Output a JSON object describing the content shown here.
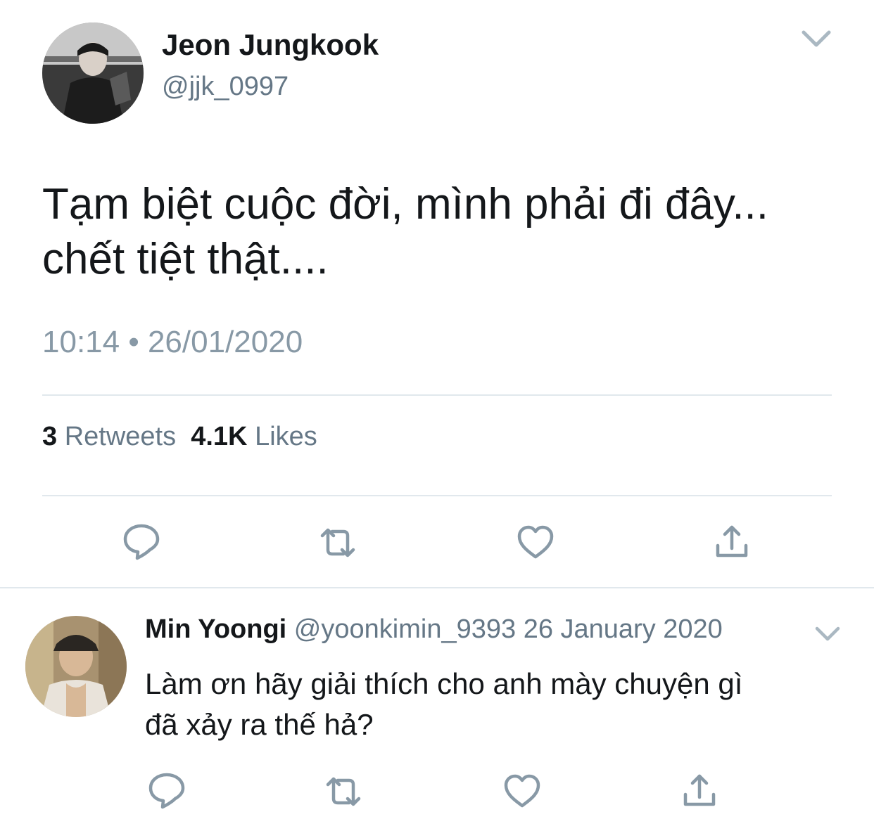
{
  "colors": {
    "text_primary": "#14171a",
    "text_secondary": "#657786",
    "icon_gray": "#8899a6",
    "divider": "#e1e8ed"
  },
  "main_tweet": {
    "author_name": "Jeon Jungkook",
    "author_handle": "@jjk_0997",
    "text_line_1": "Tạm biệt cuộc đời, mình phải đi đây...",
    "text_line_2": "chết tiệt thật....",
    "timestamp": "10:14 • 26/01/2020",
    "stats": {
      "retweets_count": "3",
      "retweets_label": "Retweets",
      "likes_count": "4.1K",
      "likes_label": "Likes"
    },
    "actions": [
      "reply-icon",
      "retweet-icon",
      "like-icon",
      "share-icon"
    ]
  },
  "reply": {
    "author_name": "Min Yoongi",
    "author_handle": "@yoonkimin_9393",
    "date": "26 January 2020",
    "text_line_1": "Làm ơn hãy giải thích cho anh mày chuyện gì",
    "text_line_2": "đã xảy ra thế hả?",
    "actions": [
      "reply-icon",
      "retweet-icon",
      "like-icon",
      "share-icon"
    ]
  }
}
